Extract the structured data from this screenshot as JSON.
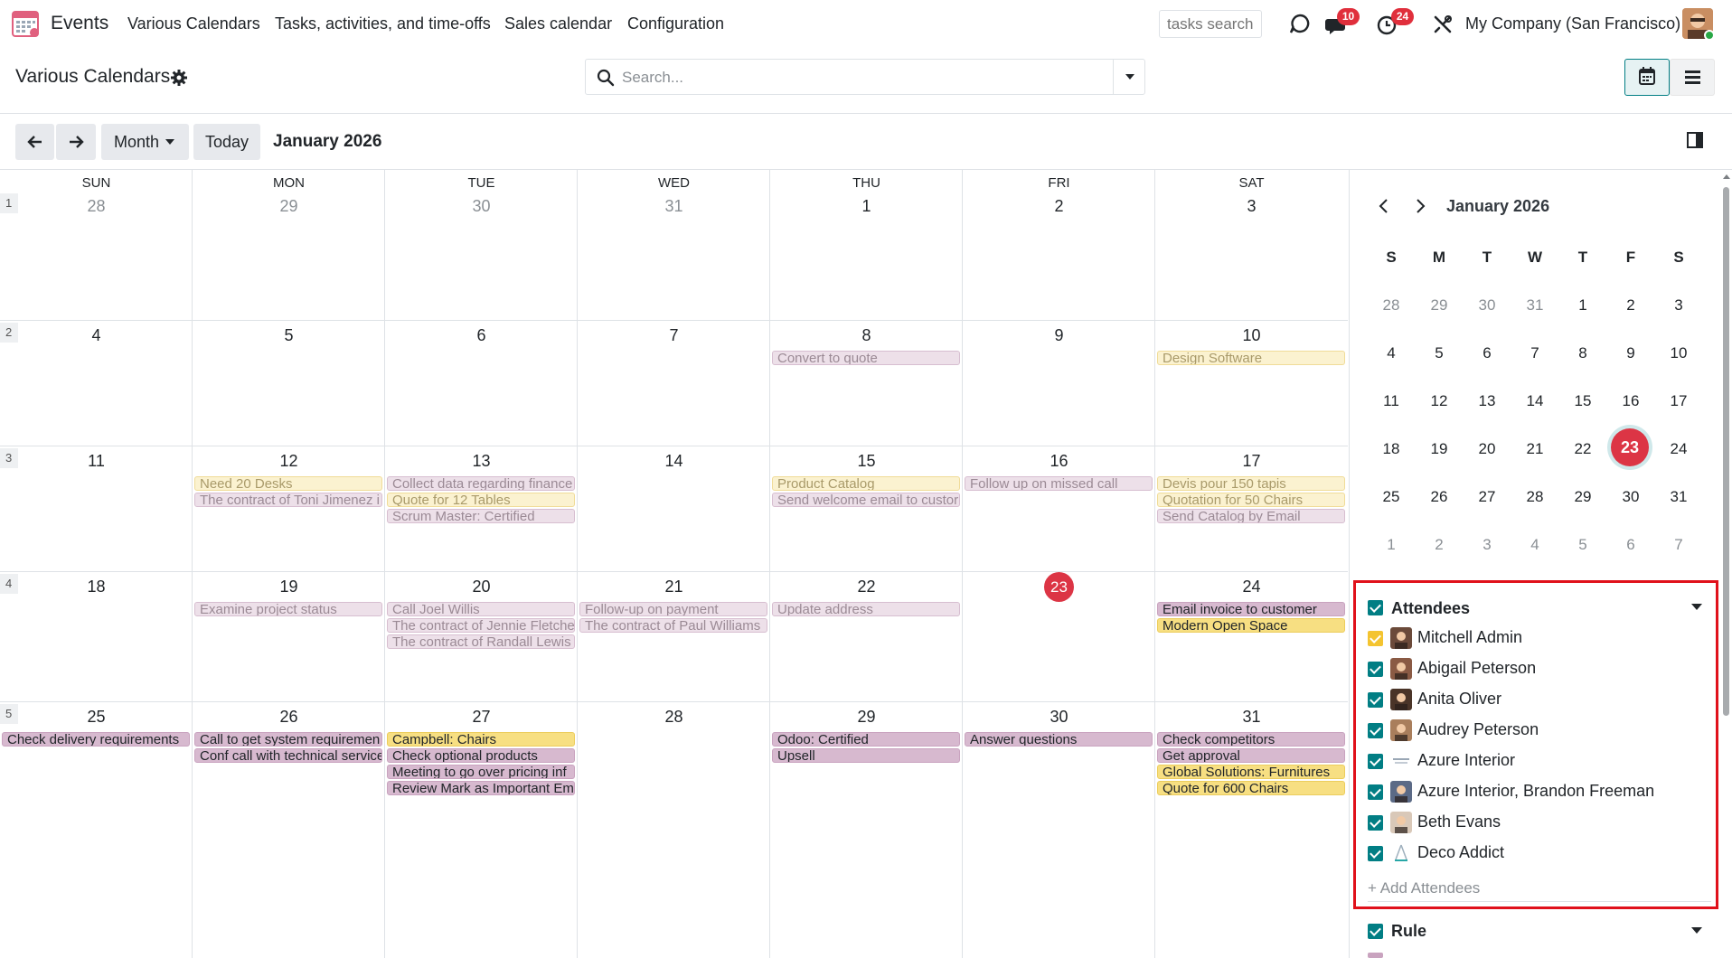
{
  "navbar": {
    "app_name": "Events",
    "menu": [
      "Various Calendars",
      "Tasks, activities, and time-offs",
      "Sales calendar",
      "Configuration"
    ],
    "tasks_search_placeholder": "tasks search",
    "messages_badge": "10",
    "activities_badge": "24",
    "company": "My Company (San Francisco)"
  },
  "control_panel": {
    "breadcrumb": "Various Calendars",
    "search_placeholder": "Search..."
  },
  "toolbar": {
    "scale": "Month",
    "today": "Today",
    "period": "January 2026"
  },
  "calendar": {
    "weekdays": [
      "SUN",
      "MON",
      "TUE",
      "WED",
      "THU",
      "FRI",
      "SAT"
    ],
    "weeks": [
      {
        "num": "1",
        "days": [
          "28",
          "29",
          "30",
          "31",
          "1",
          "2",
          "3"
        ],
        "muted": [
          true,
          true,
          true,
          true,
          false,
          false,
          false
        ]
      },
      {
        "num": "2",
        "days": [
          "4",
          "5",
          "6",
          "7",
          "8",
          "9",
          "10"
        ],
        "muted": [
          false,
          false,
          false,
          false,
          false,
          false,
          false
        ]
      },
      {
        "num": "3",
        "days": [
          "11",
          "12",
          "13",
          "14",
          "15",
          "16",
          "17"
        ],
        "muted": [
          false,
          false,
          false,
          false,
          false,
          false,
          false
        ]
      },
      {
        "num": "4",
        "days": [
          "18",
          "19",
          "20",
          "21",
          "22",
          "23",
          "24"
        ],
        "muted": [
          false,
          false,
          false,
          false,
          false,
          false,
          false
        ]
      },
      {
        "num": "5",
        "days": [
          "25",
          "26",
          "27",
          "28",
          "29",
          "30",
          "31"
        ],
        "muted": [
          false,
          false,
          false,
          false,
          false,
          false,
          false
        ]
      }
    ],
    "today_label": "23",
    "events": [
      {
        "week": 1,
        "day": 4,
        "slot": 0,
        "label": "Convert to quote",
        "style": "fp"
      },
      {
        "week": 1,
        "day": 6,
        "slot": 0,
        "label": "Design Software",
        "style": "fy"
      },
      {
        "week": 2,
        "day": 1,
        "slot": 0,
        "label": "Need 20 Desks",
        "style": "fy"
      },
      {
        "week": 2,
        "day": 1,
        "slot": 1,
        "label": "The contract of Toni Jimenez i",
        "style": "fp"
      },
      {
        "week": 2,
        "day": 2,
        "slot": 0,
        "label": "Collect data regarding finance",
        "style": "fp"
      },
      {
        "week": 2,
        "day": 2,
        "slot": 1,
        "label": "Quote for 12 Tables",
        "style": "fy"
      },
      {
        "week": 2,
        "day": 2,
        "slot": 2,
        "label": "Scrum Master: Certified",
        "style": "fp"
      },
      {
        "week": 2,
        "day": 4,
        "slot": 0,
        "label": "Product Catalog",
        "style": "fy"
      },
      {
        "week": 2,
        "day": 4,
        "slot": 1,
        "label": "Send welcome email to custor",
        "style": "fp"
      },
      {
        "week": 2,
        "day": 5,
        "slot": 0,
        "label": "Follow up on missed call",
        "style": "fp"
      },
      {
        "week": 2,
        "day": 6,
        "slot": 0,
        "label": "Devis pour 150 tapis",
        "style": "fy"
      },
      {
        "week": 2,
        "day": 6,
        "slot": 1,
        "label": "Quotation for 50 Chairs",
        "style": "fy"
      },
      {
        "week": 2,
        "day": 6,
        "slot": 2,
        "label": "Send Catalog by Email",
        "style": "fp"
      },
      {
        "week": 3,
        "day": 1,
        "slot": 0,
        "label": "Examine project status",
        "style": "fp"
      },
      {
        "week": 3,
        "day": 2,
        "slot": 0,
        "label": "Call Joel Willis",
        "style": "fp"
      },
      {
        "week": 3,
        "day": 2,
        "slot": 1,
        "label": "The contract of Jennie Fletche",
        "style": "fp"
      },
      {
        "week": 3,
        "day": 2,
        "slot": 2,
        "label": "The contract of Randall Lewis",
        "style": "fp"
      },
      {
        "week": 3,
        "day": 3,
        "slot": 0,
        "label": "Follow-up on payment",
        "style": "fp"
      },
      {
        "week": 3,
        "day": 3,
        "slot": 1,
        "label": "The contract of Paul Williams",
        "style": "fp"
      },
      {
        "week": 3,
        "day": 4,
        "slot": 0,
        "label": "Update address",
        "style": "fp"
      },
      {
        "week": 3,
        "day": 6,
        "slot": 0,
        "label": "Email invoice to customer",
        "style": "sp"
      },
      {
        "week": 3,
        "day": 6,
        "slot": 1,
        "label": "Modern Open Space",
        "style": "sy"
      },
      {
        "week": 4,
        "day": 0,
        "slot": 0,
        "label": "Check delivery requirements",
        "style": "sp"
      },
      {
        "week": 4,
        "day": 1,
        "slot": 0,
        "label": "Call to get system requiremen",
        "style": "sp"
      },
      {
        "week": 4,
        "day": 1,
        "slot": 1,
        "label": "Conf call with technical service",
        "style": "sp"
      },
      {
        "week": 4,
        "day": 2,
        "slot": 0,
        "label": "Campbell: Chairs",
        "style": "sy"
      },
      {
        "week": 4,
        "day": 2,
        "slot": 1,
        "label": "Check optional products",
        "style": "sp"
      },
      {
        "week": 4,
        "day": 2,
        "slot": 2,
        "label": "Meeting to go over pricing inf",
        "style": "sp"
      },
      {
        "week": 4,
        "day": 2,
        "slot": 3,
        "label": "Review Mark as Important Em",
        "style": "sp"
      },
      {
        "week": 4,
        "day": 4,
        "slot": 0,
        "label": "Odoo: Certified",
        "style": "sp"
      },
      {
        "week": 4,
        "day": 4,
        "slot": 1,
        "label": "Upsell",
        "style": "sp"
      },
      {
        "week": 4,
        "day": 5,
        "slot": 0,
        "label": "Answer questions",
        "style": "sp"
      },
      {
        "week": 4,
        "day": 6,
        "slot": 0,
        "label": "Check competitors",
        "style": "sp"
      },
      {
        "week": 4,
        "day": 6,
        "slot": 1,
        "label": "Get approval",
        "style": "sp"
      },
      {
        "week": 4,
        "day": 6,
        "slot": 2,
        "label": "Global Solutions: Furnitures",
        "style": "sy"
      },
      {
        "week": 4,
        "day": 6,
        "slot": 3,
        "label": "Quote for 600 Chairs",
        "style": "sy"
      }
    ]
  },
  "mini_calendar": {
    "title": "January 2026",
    "weekdays": [
      "S",
      "M",
      "T",
      "W",
      "T",
      "F",
      "S"
    ],
    "rows": [
      [
        "28",
        "29",
        "30",
        "31",
        "1",
        "2",
        "3"
      ],
      [
        "4",
        "5",
        "6",
        "7",
        "8",
        "9",
        "10"
      ],
      [
        "11",
        "12",
        "13",
        "14",
        "15",
        "16",
        "17"
      ],
      [
        "18",
        "19",
        "20",
        "21",
        "22",
        "23",
        "24"
      ],
      [
        "25",
        "26",
        "27",
        "28",
        "29",
        "30",
        "31"
      ],
      [
        "1",
        "2",
        "3",
        "4",
        "5",
        "6",
        "7"
      ]
    ],
    "muted_rows": [
      [
        true,
        true,
        true,
        true,
        false,
        false,
        false
      ],
      [
        false,
        false,
        false,
        false,
        false,
        false,
        false
      ],
      [
        false,
        false,
        false,
        false,
        false,
        false,
        false
      ],
      [
        false,
        false,
        false,
        false,
        false,
        false,
        false
      ],
      [
        false,
        false,
        false,
        false,
        false,
        false,
        false
      ],
      [
        true,
        true,
        true,
        true,
        true,
        true,
        true
      ]
    ],
    "today": "23"
  },
  "filters": {
    "attendees_title": "Attendees",
    "attendees": [
      {
        "name": "Mitchell Admin",
        "color": "yellow"
      },
      {
        "name": "Abigail Peterson",
        "color": "teal"
      },
      {
        "name": "Anita Oliver",
        "color": "teal"
      },
      {
        "name": "Audrey Peterson",
        "color": "teal"
      },
      {
        "name": "Azure Interior",
        "color": "teal"
      },
      {
        "name": "Azure Interior, Brandon Freeman",
        "color": "teal"
      },
      {
        "name": "Beth Evans",
        "color": "teal"
      },
      {
        "name": "Deco Addict",
        "color": "teal"
      }
    ],
    "add_attendees": "+ Add Attendees",
    "rule_title": "Rule"
  },
  "colors": {
    "accent": "#017e84",
    "today": "#dc3545",
    "highlight_border": "#e0111b"
  }
}
